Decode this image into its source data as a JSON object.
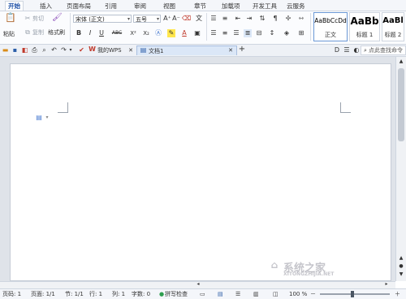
{
  "menu": {
    "tabs": [
      "开始",
      "插入",
      "页面布局",
      "引用",
      "审阅",
      "视图",
      "章节",
      "加载项",
      "开发工具",
      "云服务"
    ]
  },
  "ribbon": {
    "paste": "粘贴",
    "cut": "剪切",
    "copy": "复制",
    "format_painter": "格式刷",
    "font_name": "宋体 (正文)",
    "font_size": "五号",
    "grow_font": "A⁺",
    "shrink_font": "A⁻",
    "bold": "B",
    "italic": "I",
    "underline": "U",
    "strike": "ABC",
    "superscript": "X²",
    "subscript": "X₂",
    "font_color": "A",
    "styles": [
      {
        "preview": "AaBbCcDd",
        "caption": "正文"
      },
      {
        "preview": "AaBb",
        "caption": "标题 1"
      },
      {
        "preview": "AaBl",
        "caption": "标题 2"
      }
    ]
  },
  "tabstrip": {
    "wps_tab": "我的WPS",
    "doc_tab": "文档1",
    "add": "+",
    "search_placeholder": "点此查找命令"
  },
  "status": {
    "page": "页码: 1",
    "pages": "页面: 1/1",
    "section": "节: 1/1",
    "row": "行: 1",
    "col": "列: 1",
    "words": "字数: 0",
    "spell": "拼写检查",
    "zoom": "100 %"
  },
  "watermark": "系统之家",
  "watermark_url": "XITONGZHIJIA.NET"
}
